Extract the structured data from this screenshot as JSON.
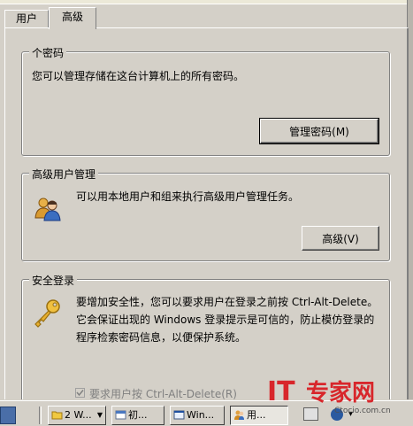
{
  "tabs": [
    {
      "label": "用户"
    },
    {
      "label": "高级"
    }
  ],
  "passwords_group": {
    "title": "个密码",
    "description": "您可以管理存储在这台计算机上的所有密码。",
    "manage_button": "管理密码(M)"
  },
  "advanced_user_group": {
    "title": "高级用户管理",
    "description": "可以用本地用户和组来执行高级用户管理任务。",
    "advanced_button": "高级(V)"
  },
  "secure_logon_group": {
    "title": "安全登录",
    "line1": "要增加安全性，您可以要求用户在登录之前按 Ctrl-Alt-Delete。",
    "line2": "它会保证出现的 Windows 登录提示是可信的，防止模仿登录的",
    "line3": "程序检索密码信息，以便保护系统。",
    "checkbox_label": "要求用户按 Ctrl-Alt-Delete(R)",
    "checkbox_checked": true
  },
  "taskbar": {
    "items": [
      {
        "label": "2 W..."
      },
      {
        "label": "初..."
      },
      {
        "label": "Win..."
      },
      {
        "label": "用..."
      }
    ]
  },
  "watermark": {
    "brand_it": "IT",
    "brand_cn": "专家网",
    "site": "Ctocio.com.cn"
  },
  "colors": {
    "face": "#d4d0c8",
    "watermark_red": "#d8262b"
  }
}
